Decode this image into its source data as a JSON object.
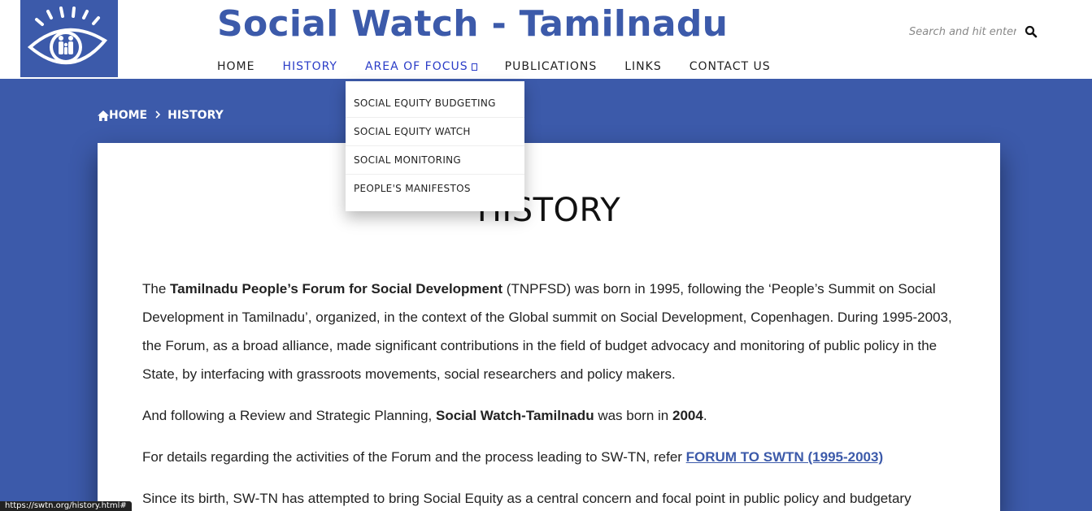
{
  "header": {
    "logo_icon": "eye-with-family-logo-icon",
    "site_title": "Social Watch - Tamilnadu",
    "nav": [
      {
        "label": "HOME"
      },
      {
        "label": "HISTORY"
      },
      {
        "label": "AREA OF FOCUS",
        "caret": "▫"
      },
      {
        "label": "PUBLICATIONS"
      },
      {
        "label": "LINKS"
      },
      {
        "label": "CONTACT US"
      }
    ],
    "search": {
      "placeholder": "Search and hit enter..",
      "icon": "search-icon"
    }
  },
  "dropdown": {
    "items": [
      {
        "label": "SOCIAL EQUITY BUDGETING"
      },
      {
        "label": "SOCIAL EQUITY WATCH"
      },
      {
        "label": "SOCIAL MONITORING"
      },
      {
        "label": "PEOPLE'S MANIFESTOS"
      }
    ]
  },
  "breadcrumb": {
    "home_icon": "home-icon",
    "home_label": "HOME",
    "separator_icon": "chevron-right-icon",
    "current": "HISTORY"
  },
  "main": {
    "title": "HISTORY",
    "p1": {
      "before": "The ",
      "bold": "Tamilnadu People’s Forum for Social Development",
      "after": " (TNPFSD) was born in 1995, following the ‘People’s Summit on Social Development in Tamilnadu’, organized, in the context of the Global summit on Social Development, Copenhagen. During 1995-2003, the Forum, as a broad alliance, made significant contributions in the field of budget advocacy and monitoring of public policy in the State, by interfacing with grassroots movements, social researchers and policy makers."
    },
    "p2": {
      "before": "And following a Review and Strategic Planning, ",
      "bold1": "Social Watch-Tamilnadu",
      "middle": " was born in ",
      "bold2": "2004",
      "after": "."
    },
    "p3": {
      "before": "For details regarding the activities of the Forum and the process leading to SW-TN, refer ",
      "link": "FORUM TO SWTN (1995-2003)"
    },
    "p4": "Since its birth, SW-TN has attempted to bring Social Equity as a central concern and focal point in public policy and budgetary"
  },
  "status_bar": {
    "url": "https://swtn.org/history.html#"
  },
  "colors": {
    "brand": "#3c5aaa",
    "nav_active": "#2a3cc7"
  }
}
